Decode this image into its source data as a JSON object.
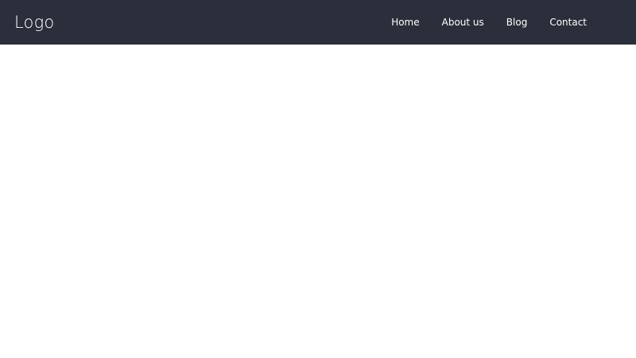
{
  "header": {
    "logo": "Logo",
    "nav": [
      {
        "label": "Home"
      },
      {
        "label": "About us"
      },
      {
        "label": "Blog"
      },
      {
        "label": "Contact"
      }
    ]
  },
  "colors": {
    "header_background": "#2b2f3b",
    "header_text": "#ffffff",
    "page_background": "#ffffff"
  }
}
